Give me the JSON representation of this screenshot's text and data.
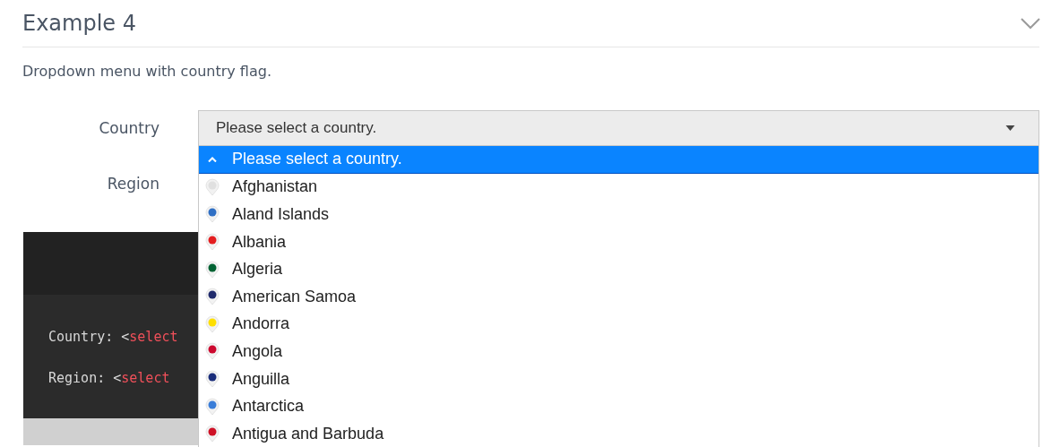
{
  "section": {
    "title": "Example 4",
    "expanded": true
  },
  "description": "Dropdown menu with country flag.",
  "form": {
    "country_label": "Country",
    "country_value": "Please select a country.",
    "region_label": "Region"
  },
  "dropdown": {
    "options": [
      {
        "label": "Please select a country.",
        "selected": true,
        "kind": "placeholder"
      },
      {
        "label": "Afghanistan",
        "selected": false,
        "kind": "country",
        "color": "#e0e0e0"
      },
      {
        "label": "Aland Islands",
        "selected": false,
        "kind": "country",
        "color": "#2f6fc4"
      },
      {
        "label": "Albania",
        "selected": false,
        "kind": "country",
        "color": "#e41e20"
      },
      {
        "label": "Algeria",
        "selected": false,
        "kind": "country",
        "color": "#006233"
      },
      {
        "label": "American Samoa",
        "selected": false,
        "kind": "country",
        "color": "#1f2a6b"
      },
      {
        "label": "Andorra",
        "selected": false,
        "kind": "country",
        "color": "#fedf00"
      },
      {
        "label": "Angola",
        "selected": false,
        "kind": "country",
        "color": "#cc092f"
      },
      {
        "label": "Anguilla",
        "selected": false,
        "kind": "country",
        "color": "#1a2d7a"
      },
      {
        "label": "Antarctica",
        "selected": false,
        "kind": "country",
        "color": "#3a7dd8"
      },
      {
        "label": "Antigua and Barbuda",
        "selected": false,
        "kind": "country",
        "color": "#ce1126"
      }
    ]
  },
  "code": {
    "lines": [
      [
        {
          "text": "Country: <",
          "kind": "plain"
        },
        {
          "text": "select",
          "kind": "tag"
        }
      ],
      [
        {
          "text": "Region: <",
          "kind": "plain"
        },
        {
          "text": "select",
          "kind": "tag"
        }
      ]
    ]
  }
}
